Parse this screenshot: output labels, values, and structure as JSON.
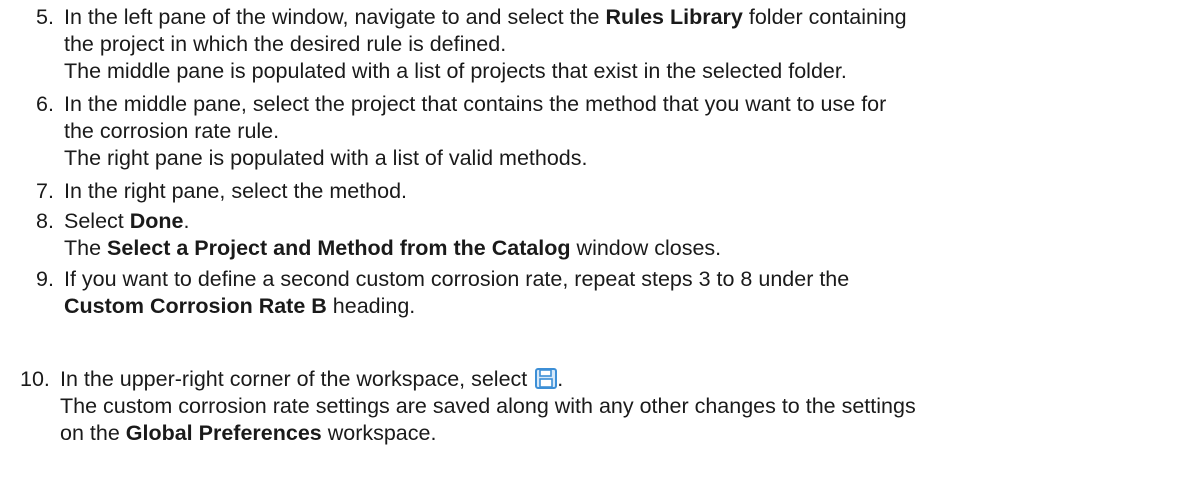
{
  "steps": [
    {
      "number": "5.",
      "l1a": "In the left pane of the window, navigate to and select the ",
      "l1b": "Rules Library",
      "l1c": " folder containing",
      "l2": "the project in which the desired rule is defined.",
      "l3": "The middle pane is populated with a list of projects that exist in the selected folder."
    },
    {
      "number": "6.",
      "l1": "In the middle pane, select the project that contains the method that you want to use for",
      "l2": "the corrosion rate rule.",
      "l3": "The right pane is populated with a list of valid methods."
    },
    {
      "number": "7.",
      "l1": "In the right pane, select the method."
    },
    {
      "number": "8.",
      "l1a": "Select ",
      "l1b": "Done",
      "l1c": ".",
      "l2a": "The ",
      "l2b": "Select a Project and Method from the Catalog",
      "l2c": " window closes."
    },
    {
      "number": "9.",
      "l1": "If you want to define a second custom corrosion rate, repeat steps 3 to 8 under the",
      "l2a": "Custom Corrosion Rate B",
      "l2b": " heading."
    },
    {
      "number": "10.",
      "l1a": "In the upper-right corner of the workspace, select ",
      "l1c": ".",
      "icon": "save-icon",
      "l2": "The custom corrosion rate settings are saved along with any other changes to the settings",
      "l3a": "on the ",
      "l3b": "Global Preferences",
      "l3c": " workspace."
    }
  ],
  "colors": {
    "text": "#1a1a1a",
    "icon_blue": "#3d8fd6",
    "icon_fill": "#d6e9fa"
  }
}
